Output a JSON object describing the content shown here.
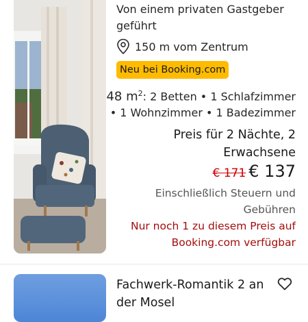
{
  "listing1": {
    "host_line": "Von einem privaten Gastgeber geführt",
    "distance": "150 m vom Zentrum",
    "badge": "Neu bei Booking.com",
    "size_prefix": "48 m",
    "size_sup": "2",
    "rooms_line1": ": 2 Betten • 1 Schlafzimmer",
    "rooms_line2": "• 1 Wohnzimmer • 1 Badezimmer",
    "price_for": "Preis für 2 Nächte, 2 Erwachsene",
    "old_price": "€ 171",
    "new_price": "€ 137",
    "taxes": "Einschließlich Steuern und Gebühren",
    "scarcity": "Nur noch 1 zu diesem Preis auf Booking.com verfügbar",
    "icons": {
      "location": "map-pin-icon"
    },
    "colors": {
      "badge": "#febb02",
      "old_price": "#cc0000",
      "scarcity": "#a30d0d"
    }
  },
  "listing2": {
    "title": "Fachwerk-Romantik 2 an der Mosel",
    "icons": {
      "favorite": "heart-outline-icon"
    }
  }
}
